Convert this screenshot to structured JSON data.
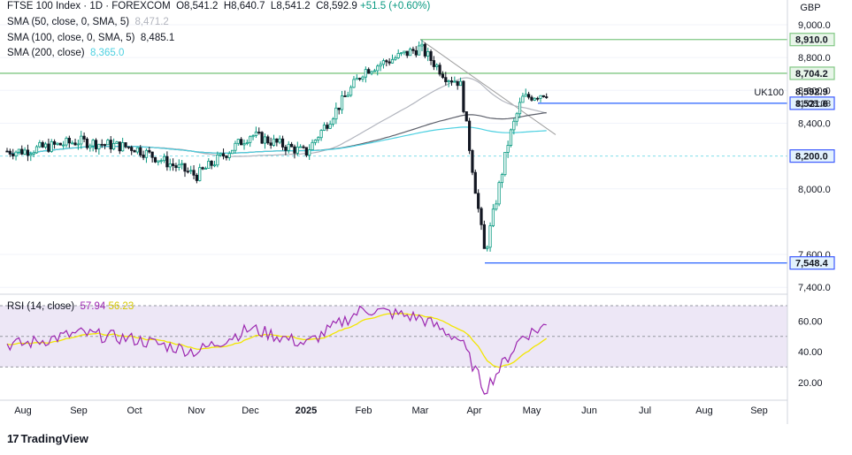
{
  "legend": {
    "title": "FTSE 100 Index · 1D · FOREXCOM",
    "o_label": "O",
    "o": "8,541.2",
    "h_label": "H",
    "h": "8,640.7",
    "l_label": "L",
    "l": "8,541.2",
    "c_label": "C",
    "c": "8,592.9",
    "chg": "+51.5 (+0.60%)",
    "sma50_label": "SMA (50, close, 0, SMA, 5)",
    "sma50_value": "8,471.2",
    "sma100_label": "SMA (100, close, 0, SMA, 5)",
    "sma100_value": "8,485.1",
    "sma200_label": "SMA (200, close)",
    "sma200_value": "8,365.0",
    "rsi_label": "RSI (14, close)",
    "rsi_value": "57.94",
    "rsi_ma_value": "56.23"
  },
  "currency": "GBP",
  "symbol_tag": "UK100",
  "countdown": "11:08:08",
  "branding": "TradingView",
  "colors": {
    "up": "#089981",
    "down": "#131722",
    "sma50": "#b2b5be",
    "sma100": "#5d606b",
    "sma200": "#4dd0e1",
    "green_level": "#81c784",
    "blue_level": "#2962ff",
    "rsi_line": "#9c27b0",
    "rsi_ma": "#f2e600",
    "rsi_band": "#ede7f6"
  },
  "chart_data": [
    {
      "type": "candlestick",
      "x_ticks": [
        "Aug",
        "Sep",
        "Oct",
        "Nov",
        "Dec",
        "2025",
        "Feb",
        "Mar",
        "Apr",
        "May",
        "Jun",
        "Jul",
        "Aug",
        "Sep"
      ],
      "y_ticks": [
        "7,400.0",
        "7,600.0",
        "8,000.0",
        "8,400.0",
        "8,600.0",
        "8,800.0",
        "9,000.0"
      ],
      "ylim": [
        7300,
        9100
      ],
      "candle_path": [
        [
          "Aug",
          8230
        ],
        [
          "Sep",
          8290
        ],
        [
          "Oct",
          8250
        ],
        [
          "Nov",
          8080
        ],
        [
          "Dec",
          8330
        ],
        [
          "2025",
          8220
        ],
        [
          "Feb",
          8720
        ],
        [
          "Mar",
          8860
        ],
        [
          "Mar",
          8680
        ],
        [
          "Apr",
          8650
        ],
        [
          "Apr",
          7600
        ],
        [
          "Apr",
          8300
        ],
        [
          "May",
          8550
        ],
        [
          "May",
          8592.9
        ]
      ],
      "price_labels": [
        {
          "value": "8,910.0",
          "kind": "green"
        },
        {
          "value": "8,704.2",
          "kind": "green"
        },
        {
          "value": "8,592.9",
          "kind": "current"
        },
        {
          "value": "8,521.6",
          "kind": "blue"
        },
        {
          "value": "8,200.0",
          "kind": "blue"
        },
        {
          "value": "7,548.4",
          "kind": "blue"
        }
      ],
      "levels": [
        8910.0,
        8704.2,
        8521.6,
        8200.0,
        7548.4
      ],
      "series": [
        {
          "name": "SMA (50, close, 0, SMA, 5)",
          "last": 8471.2
        },
        {
          "name": "SMA (100, close, 0, SMA, 5)",
          "last": 8485.1
        },
        {
          "name": "SMA (200, close)",
          "last": 8365.0
        }
      ]
    },
    {
      "type": "line",
      "title": "RSI (14, close)",
      "y_ticks": [
        "20.00",
        "40.00",
        "60.00"
      ],
      "ylim": [
        10,
        75
      ],
      "band": [
        30,
        70
      ],
      "path": [
        [
          "Aug",
          45
        ],
        [
          "Sep",
          52
        ],
        [
          "Oct",
          48
        ],
        [
          "Nov",
          40
        ],
        [
          "Dec",
          55
        ],
        [
          "2025",
          45
        ],
        [
          "Feb",
          68
        ],
        [
          "Mar",
          62
        ],
        [
          "Apr",
          48
        ],
        [
          "Apr",
          15
        ],
        [
          "May",
          50
        ],
        [
          "May",
          57.94
        ]
      ],
      "series": [
        {
          "name": "RSI",
          "last": 57.94
        },
        {
          "name": "RSI MA",
          "last": 56.23
        }
      ]
    }
  ]
}
